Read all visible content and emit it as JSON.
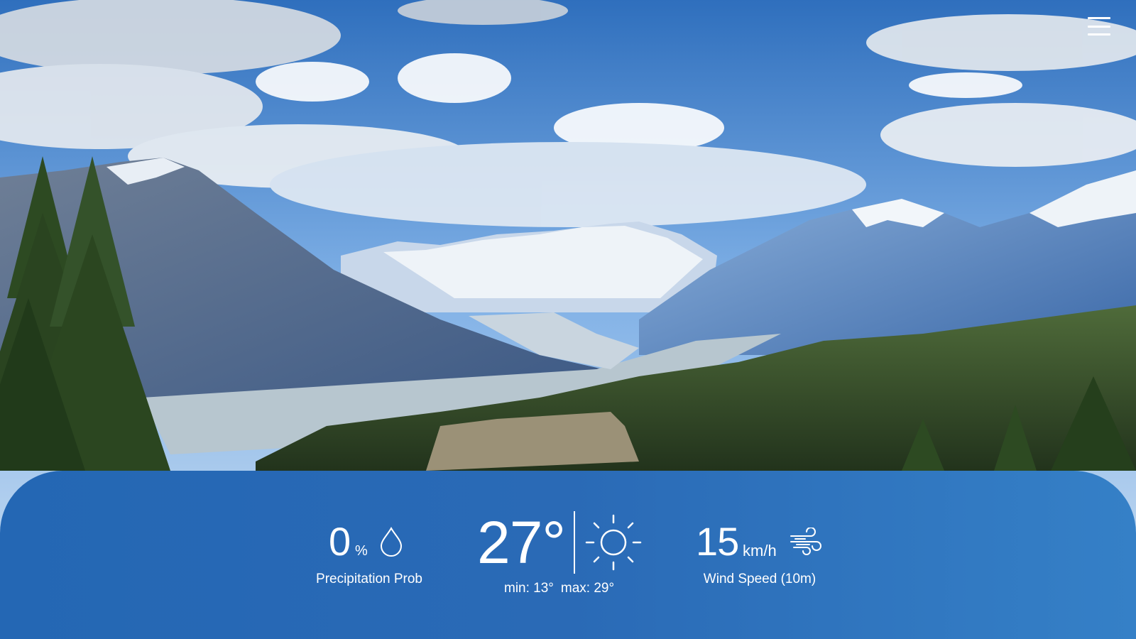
{
  "precipitation": {
    "value": "0",
    "unit": "%",
    "label": "Precipitation Prob",
    "icon": "water-drop-icon"
  },
  "temperature": {
    "value": "27°",
    "min_label": "min: 13°",
    "max_label": "max: 29°",
    "icon": "sun-icon"
  },
  "wind": {
    "value": "15",
    "unit": "km/h",
    "label": "Wind Speed (10m)",
    "icon": "wind-icon"
  },
  "menu": {
    "icon": "hamburger-menu-icon"
  },
  "colors": {
    "panel": "#2467b4",
    "panel_end": "#3580c7",
    "text": "#ffffff"
  }
}
